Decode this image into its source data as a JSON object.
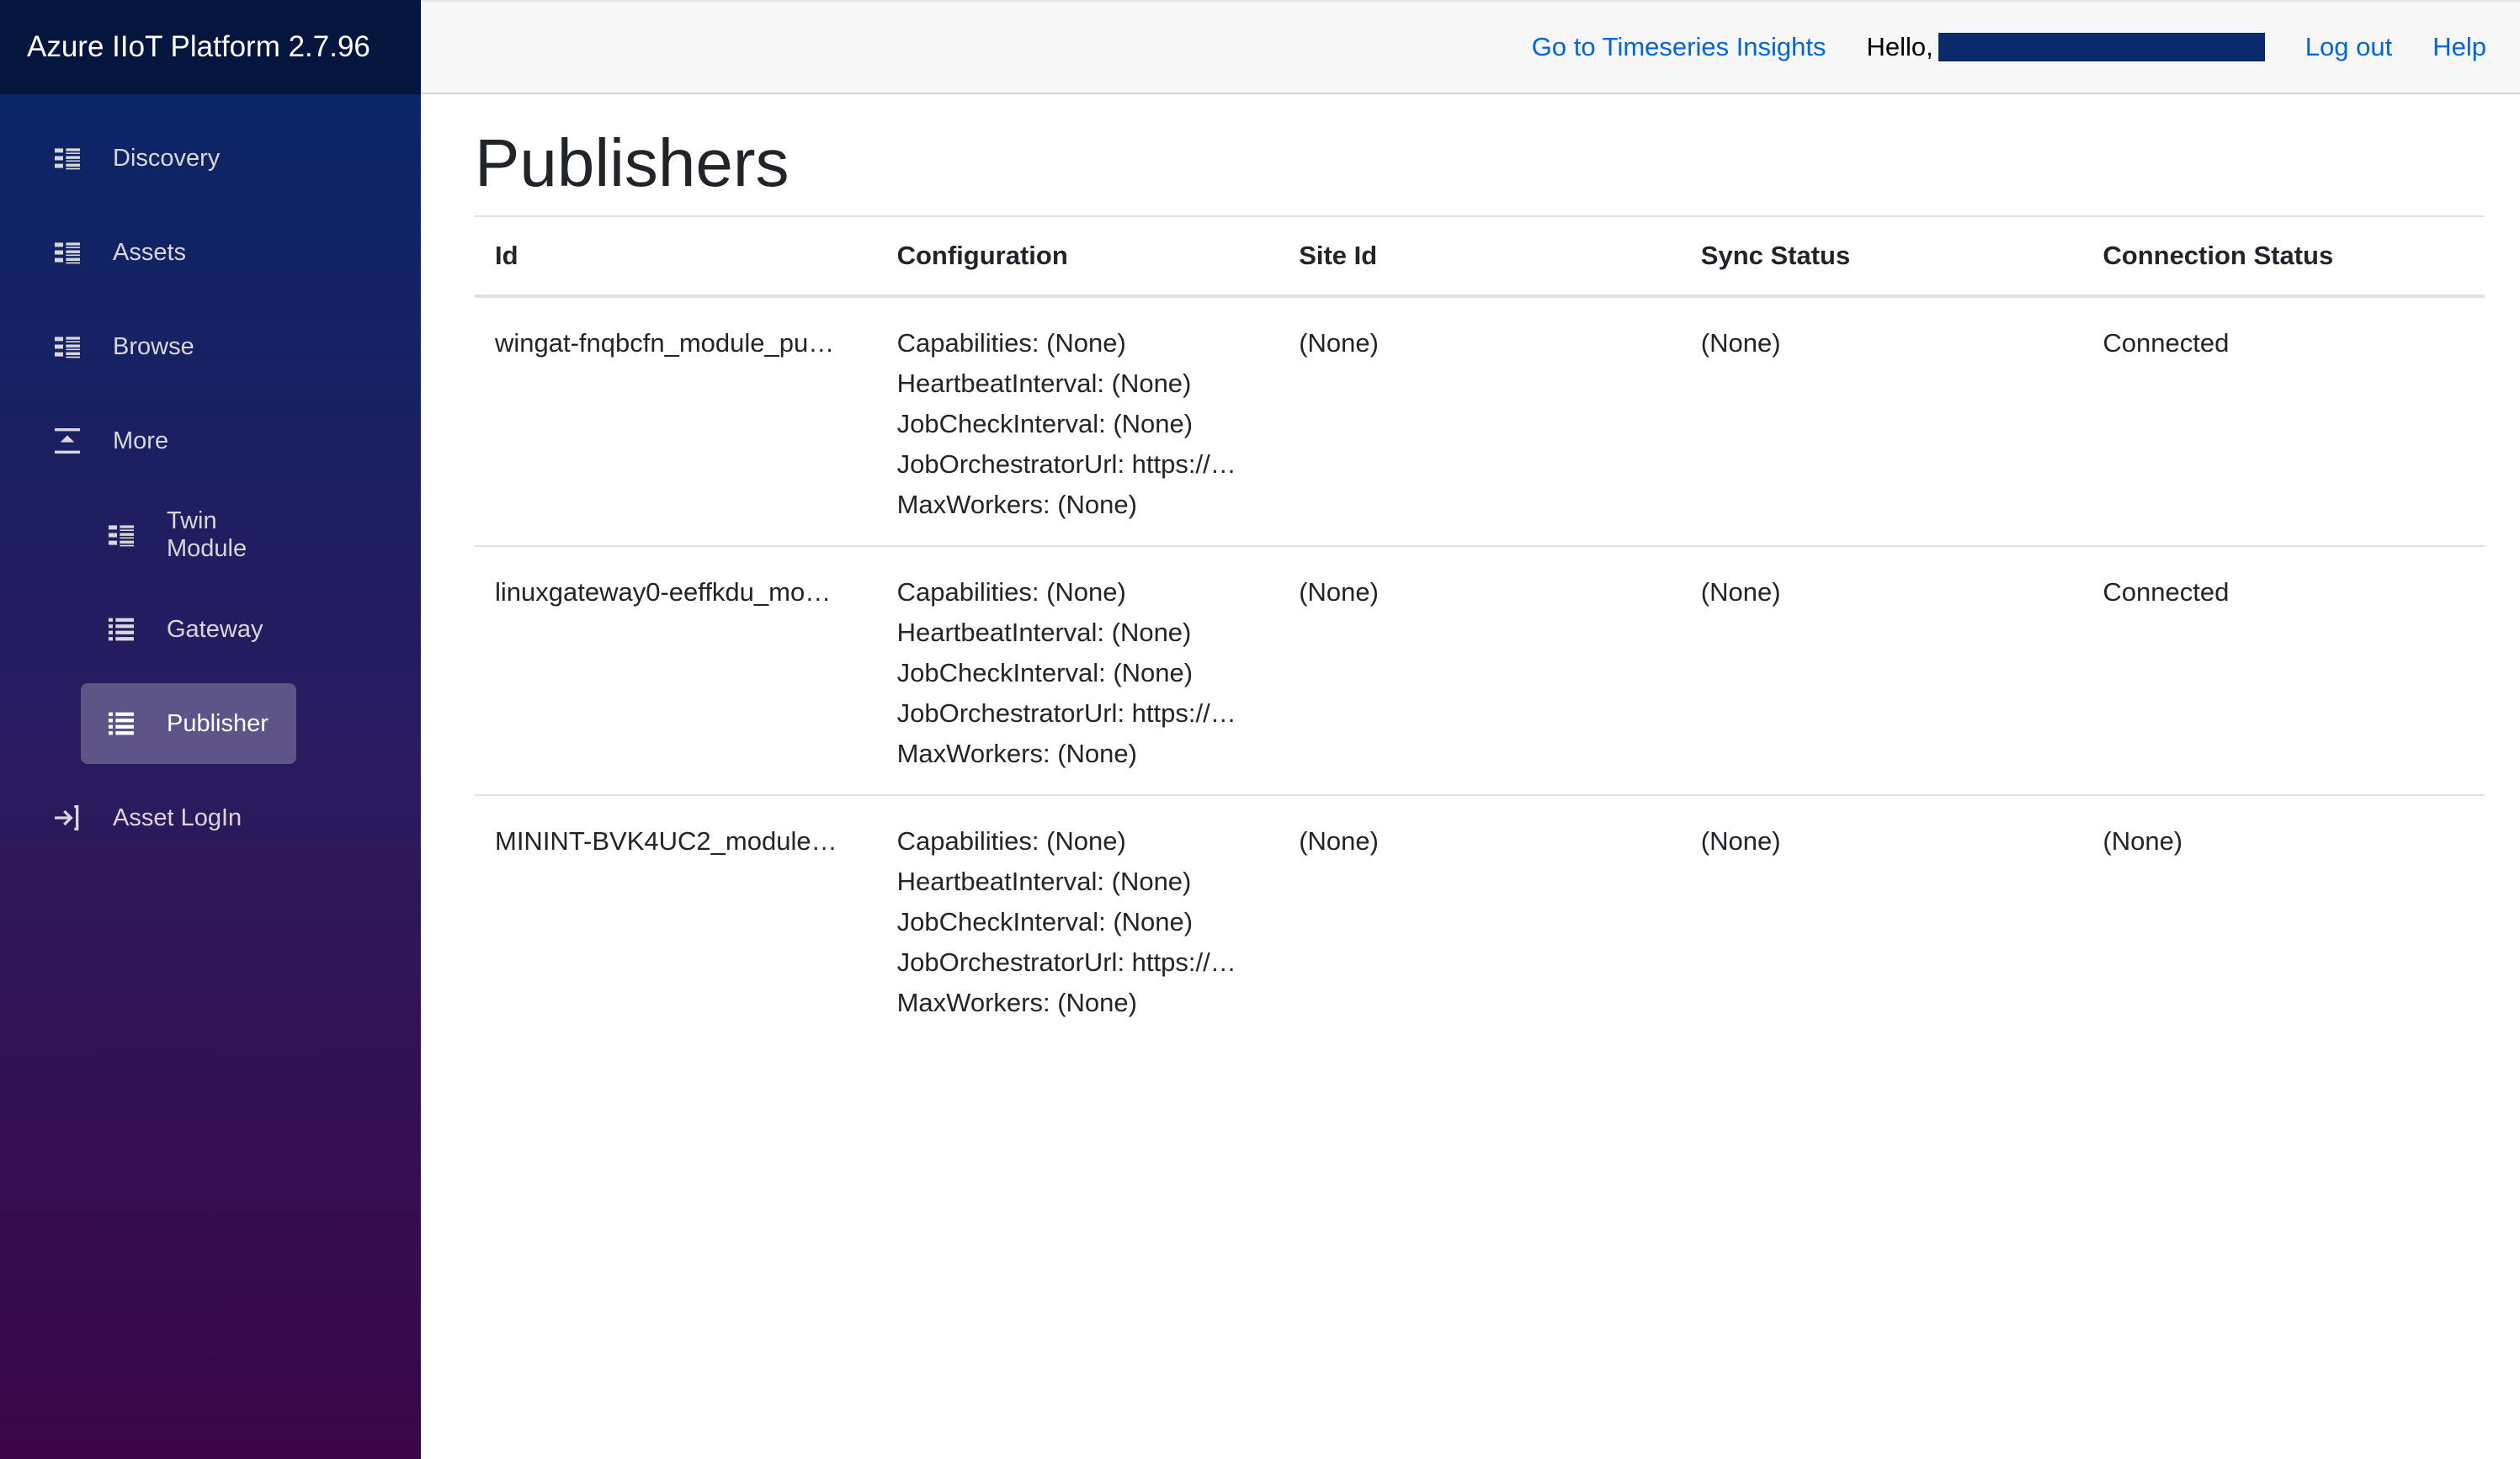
{
  "app": {
    "title": "Azure IIoT Platform 2.7.96"
  },
  "sidebar": {
    "items": [
      {
        "label": "Discovery",
        "icon": "dashboard-list-icon"
      },
      {
        "label": "Assets",
        "icon": "dashboard-list-icon"
      },
      {
        "label": "Browse",
        "icon": "dashboard-list-icon"
      },
      {
        "label": "More",
        "icon": "collapse-up-icon"
      },
      {
        "label": "Twin Module",
        "icon": "dashboard-list-icon"
      },
      {
        "label": "Gateway",
        "icon": "list-icon"
      },
      {
        "label": "Publisher",
        "icon": "list-icon"
      },
      {
        "label": "Asset LogIn",
        "icon": "login-icon"
      }
    ]
  },
  "header": {
    "timeseries_link": "Go to Timeseries Insights",
    "hello": "Hello,",
    "logout": "Log out",
    "help": "Help"
  },
  "main": {
    "title": "Publishers",
    "columns": [
      "Id",
      "Configuration",
      "Site Id",
      "Sync Status",
      "Connection Status"
    ],
    "rows": [
      {
        "id": "wingat-fnqbcfn_module_pu…",
        "config": [
          "Capabilities: (None)",
          "HeartbeatInterval: (None)",
          "JobCheckInterval: (None)",
          "JobOrchestratorUrl: https://…",
          "MaxWorkers: (None)"
        ],
        "site": "(None)",
        "sync": "(None)",
        "connection": "Connected"
      },
      {
        "id": "linuxgateway0-eeffkdu_mo…",
        "config": [
          "Capabilities: (None)",
          "HeartbeatInterval: (None)",
          "JobCheckInterval: (None)",
          "JobOrchestratorUrl: https://…",
          "MaxWorkers: (None)"
        ],
        "site": "(None)",
        "sync": "(None)",
        "connection": "Connected"
      },
      {
        "id": "MININT-BVK4UC2_module…",
        "config": [
          "Capabilities: (None)",
          "HeartbeatInterval: (None)",
          "JobCheckInterval: (None)",
          "JobOrchestratorUrl: https://…",
          "MaxWorkers: (None)"
        ],
        "site": "(None)",
        "sync": "(None)",
        "connection": "(None)"
      }
    ]
  },
  "colors": {
    "accent_link": "#0366d6",
    "sidebar_top": "#052767",
    "sidebar_bottom": "#3a0647"
  }
}
